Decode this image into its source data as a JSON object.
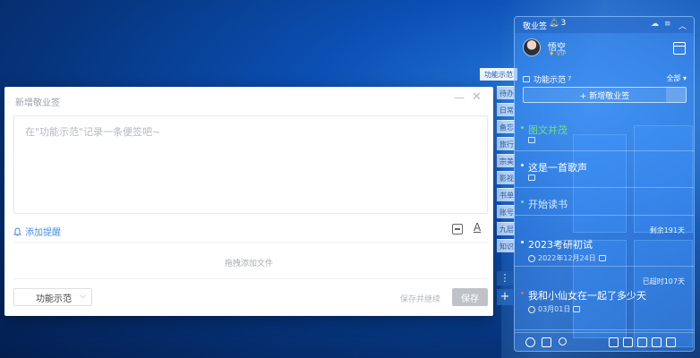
{
  "dialog": {
    "title": "新增敬业签",
    "minimize_glyph": "—",
    "close_glyph": "✕",
    "placeholder": "在\"功能示范\"记录一条便签吧~",
    "add_reminder": "添加提醒",
    "reminder_icon": "bell-icon",
    "drop_hint": "拖拽添加文件",
    "category": "功能示范",
    "save_and_continue": "保存并继续",
    "save": "保存"
  },
  "middle": {
    "main_tab": "功能示范",
    "tabs": [
      "待办",
      "日常",
      "备忘",
      "旅行",
      "宗美",
      "影视",
      "书单",
      "账号",
      "九层",
      "知识"
    ],
    "more_glyph": "⋮",
    "add_glyph": "+"
  },
  "panel": {
    "app_name": "敬业签",
    "notification_count": "3",
    "user": {
      "name": "悟空",
      "badge": "VIP"
    },
    "folder": {
      "name": "功能示范",
      "count": "7",
      "filter": "全部"
    },
    "add_note": "+ 新增敬业签",
    "notes": [
      {
        "text": "图文并茂",
        "color": "#6ee07a",
        "dot": "#6ee07a"
      },
      {
        "text": "这是一首歌声",
        "color": "#ffffff",
        "dot": "#ffffff"
      },
      {
        "text": "开始读书",
        "color": "#d6ecff",
        "dot": "#6ee07a"
      },
      {
        "text": "2023考研初试",
        "color": "#ffffff",
        "dot": "#ffffff",
        "tag": "剩余191天",
        "date": "2022年12月24日"
      },
      {
        "text": "我和小仙女在一起了多少天",
        "color": "#ffffff",
        "dot": "#ff5a5a",
        "tag": "已超时107天",
        "date": "03月01日"
      }
    ],
    "footer_icons": [
      "clock-icon",
      "check-box-icon",
      "search-icon",
      "add-box-icon",
      "columns-icon",
      "view-icon",
      "calendar-icon",
      "menu-icon"
    ]
  }
}
